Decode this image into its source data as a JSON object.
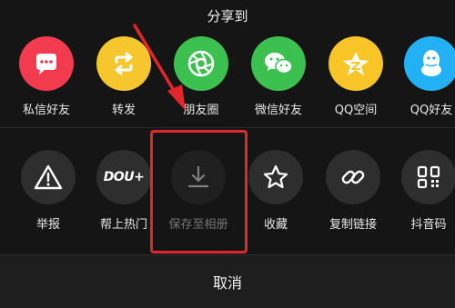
{
  "sheet": {
    "title": "分享到"
  },
  "share_row": [
    {
      "label": "私信好友",
      "icon": "chat-bubble-icon",
      "color": "#f23b4f"
    },
    {
      "label": "转发",
      "icon": "repost-icon",
      "color": "#f6c62e"
    },
    {
      "label": "朋友圈",
      "icon": "moments-aperture-icon",
      "color": "#3cc151"
    },
    {
      "label": "微信好友",
      "icon": "wechat-icon",
      "color": "#3cc151"
    },
    {
      "label": "QQ空间",
      "icon": "qzone-star-icon",
      "color": "#f8c529"
    },
    {
      "label": "QQ好友",
      "icon": "qq-penguin-icon",
      "color": "#23b1f3"
    }
  ],
  "action_row": [
    {
      "label": "举报",
      "icon": "warning-icon"
    },
    {
      "label": "帮上热门",
      "icon": "dou-plus-icon",
      "badge_text": "DOU+"
    },
    {
      "label": "保存至相册",
      "icon": "download-icon",
      "disabled": true
    },
    {
      "label": "收藏",
      "icon": "star-icon"
    },
    {
      "label": "复制链接",
      "icon": "link-icon"
    },
    {
      "label": "抖音码",
      "icon": "qr-code-icon"
    }
  ],
  "cancel": {
    "label": "取消"
  },
  "annotation": {
    "highlight_color": "#e3262b"
  }
}
